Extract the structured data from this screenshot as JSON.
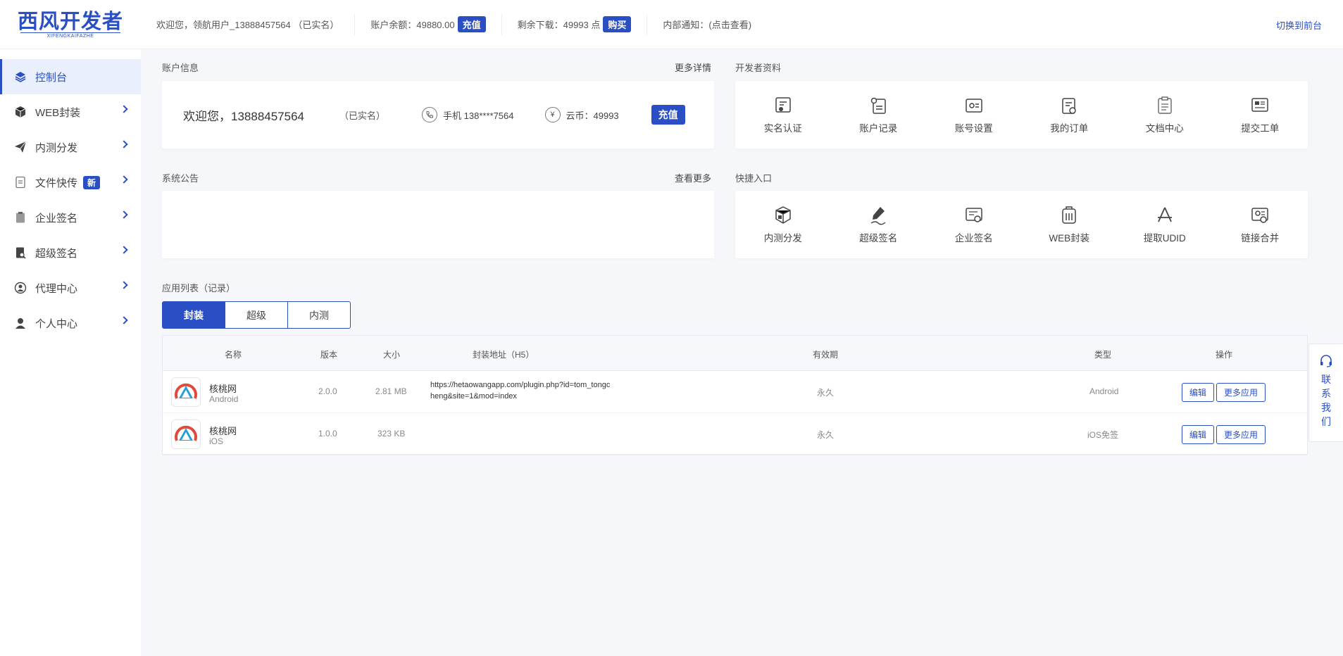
{
  "brand": {
    "name_cn": "西风开发者",
    "name_en": "XIFENGKAIFAZHE",
    "color": "#2a4fc4"
  },
  "topbar": {
    "welcome": "欢迎您，领航用户_13888457564 （已实名）",
    "balance_label": "账户余额：49880.00",
    "recharge_label": "充值",
    "downloads_label": "剩余下载：49993 点",
    "buy_label": "购买",
    "notice_label": "内部通知：(点击查看)",
    "switch_label": "切换到前台"
  },
  "sidebar": {
    "items": [
      {
        "label": "控制台",
        "icon": "layers-icon",
        "active": true
      },
      {
        "label": "WEB封装",
        "icon": "box-icon"
      },
      {
        "label": "内测分发",
        "icon": "paper-plane-icon"
      },
      {
        "label": "文件快传",
        "icon": "file-transfer-icon",
        "badge": "新"
      },
      {
        "label": "企业签名",
        "icon": "clipboard-icon"
      },
      {
        "label": "超级签名",
        "icon": "doc-search-icon"
      },
      {
        "label": "代理中心",
        "icon": "agent-icon"
      },
      {
        "label": "个人中心",
        "icon": "user-icon"
      }
    ]
  },
  "account": {
    "title": "账户信息",
    "more": "更多详情",
    "welcome": "欢迎您，13888457564",
    "verified": "（已实名）",
    "phone": "手机 138****7564",
    "coins": "云币：49993",
    "recharge": "充值"
  },
  "dev": {
    "title": "开发者资料",
    "items": [
      {
        "label": "实名认证",
        "icon": "id-verify-icon"
      },
      {
        "label": "账户记录",
        "icon": "account-record-icon"
      },
      {
        "label": "账号设置",
        "icon": "account-settings-icon"
      },
      {
        "label": "我的订单",
        "icon": "orders-icon"
      },
      {
        "label": "文档中心",
        "icon": "docs-icon"
      },
      {
        "label": "提交工单",
        "icon": "ticket-icon"
      }
    ]
  },
  "notice": {
    "title": "系统公告",
    "more": "查看更多"
  },
  "quick": {
    "title": "快捷入口",
    "items": [
      {
        "label": "内测分发",
        "icon": "cubes-icon"
      },
      {
        "label": "超级签名",
        "icon": "pen-icon"
      },
      {
        "label": "企业签名",
        "icon": "certificate-icon"
      },
      {
        "label": "WEB封装",
        "icon": "package-icon"
      },
      {
        "label": "提取UDID",
        "icon": "appstore-icon"
      },
      {
        "label": "链接合并",
        "icon": "link-merge-icon"
      }
    ]
  },
  "apps": {
    "title": "应用列表（记录）",
    "tabs": [
      {
        "label": "封装",
        "active": true
      },
      {
        "label": "超级"
      },
      {
        "label": "内测"
      }
    ],
    "columns": {
      "name": "名称",
      "version": "版本",
      "size": "大小",
      "url": "封装地址（H5）",
      "validity": "有效期",
      "type": "类型",
      "ops": "操作"
    },
    "rows": [
      {
        "name": "核桃网",
        "platform": "Android",
        "version": "2.0.0",
        "size": "2.81 MB",
        "url": "https://hetaowangapp.com/plugin.php?id=tom_tongcheng&site=1&mod=index",
        "validity": "永久",
        "type": "Android",
        "edit": "编辑",
        "more": "更多应用"
      },
      {
        "name": "核桃网",
        "platform": "iOS",
        "version": "1.0.0",
        "size": "323 KB",
        "url": "",
        "validity": "永久",
        "type": "iOS免签",
        "edit": "编辑",
        "more": "更多应用"
      }
    ]
  },
  "contact": {
    "label": "联系我们",
    "icon": "headset-icon"
  }
}
